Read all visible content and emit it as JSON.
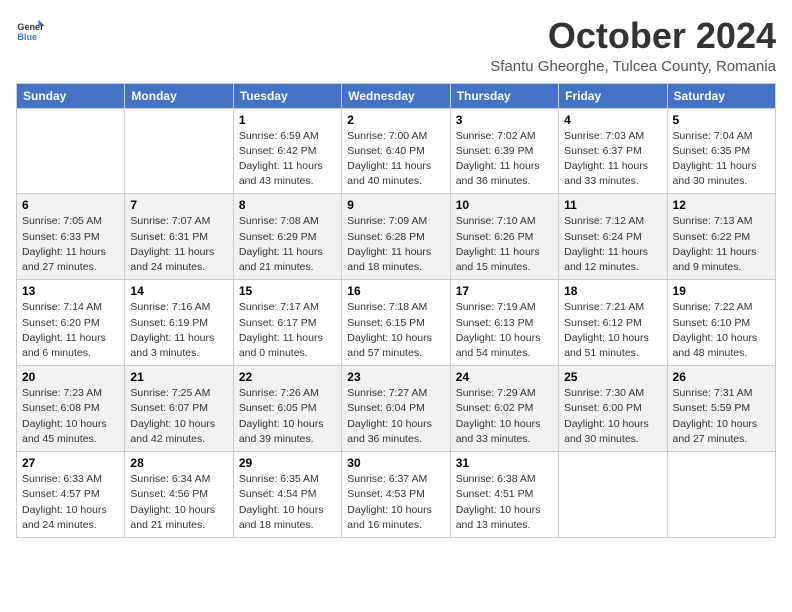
{
  "header": {
    "logo_general": "General",
    "logo_blue": "Blue",
    "month_title": "October 2024",
    "subtitle": "Sfantu Gheorghe, Tulcea County, Romania"
  },
  "weekdays": [
    "Sunday",
    "Monday",
    "Tuesday",
    "Wednesday",
    "Thursday",
    "Friday",
    "Saturday"
  ],
  "weeks": [
    [
      {
        "day": "",
        "info": ""
      },
      {
        "day": "",
        "info": ""
      },
      {
        "day": "1",
        "info": "Sunrise: 6:59 AM\nSunset: 6:42 PM\nDaylight: 11 hours and 43 minutes."
      },
      {
        "day": "2",
        "info": "Sunrise: 7:00 AM\nSunset: 6:40 PM\nDaylight: 11 hours and 40 minutes."
      },
      {
        "day": "3",
        "info": "Sunrise: 7:02 AM\nSunset: 6:39 PM\nDaylight: 11 hours and 36 minutes."
      },
      {
        "day": "4",
        "info": "Sunrise: 7:03 AM\nSunset: 6:37 PM\nDaylight: 11 hours and 33 minutes."
      },
      {
        "day": "5",
        "info": "Sunrise: 7:04 AM\nSunset: 6:35 PM\nDaylight: 11 hours and 30 minutes."
      }
    ],
    [
      {
        "day": "6",
        "info": "Sunrise: 7:05 AM\nSunset: 6:33 PM\nDaylight: 11 hours and 27 minutes."
      },
      {
        "day": "7",
        "info": "Sunrise: 7:07 AM\nSunset: 6:31 PM\nDaylight: 11 hours and 24 minutes."
      },
      {
        "day": "8",
        "info": "Sunrise: 7:08 AM\nSunset: 6:29 PM\nDaylight: 11 hours and 21 minutes."
      },
      {
        "day": "9",
        "info": "Sunrise: 7:09 AM\nSunset: 6:28 PM\nDaylight: 11 hours and 18 minutes."
      },
      {
        "day": "10",
        "info": "Sunrise: 7:10 AM\nSunset: 6:26 PM\nDaylight: 11 hours and 15 minutes."
      },
      {
        "day": "11",
        "info": "Sunrise: 7:12 AM\nSunset: 6:24 PM\nDaylight: 11 hours and 12 minutes."
      },
      {
        "day": "12",
        "info": "Sunrise: 7:13 AM\nSunset: 6:22 PM\nDaylight: 11 hours and 9 minutes."
      }
    ],
    [
      {
        "day": "13",
        "info": "Sunrise: 7:14 AM\nSunset: 6:20 PM\nDaylight: 11 hours and 6 minutes."
      },
      {
        "day": "14",
        "info": "Sunrise: 7:16 AM\nSunset: 6:19 PM\nDaylight: 11 hours and 3 minutes."
      },
      {
        "day": "15",
        "info": "Sunrise: 7:17 AM\nSunset: 6:17 PM\nDaylight: 11 hours and 0 minutes."
      },
      {
        "day": "16",
        "info": "Sunrise: 7:18 AM\nSunset: 6:15 PM\nDaylight: 10 hours and 57 minutes."
      },
      {
        "day": "17",
        "info": "Sunrise: 7:19 AM\nSunset: 6:13 PM\nDaylight: 10 hours and 54 minutes."
      },
      {
        "day": "18",
        "info": "Sunrise: 7:21 AM\nSunset: 6:12 PM\nDaylight: 10 hours and 51 minutes."
      },
      {
        "day": "19",
        "info": "Sunrise: 7:22 AM\nSunset: 6:10 PM\nDaylight: 10 hours and 48 minutes."
      }
    ],
    [
      {
        "day": "20",
        "info": "Sunrise: 7:23 AM\nSunset: 6:08 PM\nDaylight: 10 hours and 45 minutes."
      },
      {
        "day": "21",
        "info": "Sunrise: 7:25 AM\nSunset: 6:07 PM\nDaylight: 10 hours and 42 minutes."
      },
      {
        "day": "22",
        "info": "Sunrise: 7:26 AM\nSunset: 6:05 PM\nDaylight: 10 hours and 39 minutes."
      },
      {
        "day": "23",
        "info": "Sunrise: 7:27 AM\nSunset: 6:04 PM\nDaylight: 10 hours and 36 minutes."
      },
      {
        "day": "24",
        "info": "Sunrise: 7:29 AM\nSunset: 6:02 PM\nDaylight: 10 hours and 33 minutes."
      },
      {
        "day": "25",
        "info": "Sunrise: 7:30 AM\nSunset: 6:00 PM\nDaylight: 10 hours and 30 minutes."
      },
      {
        "day": "26",
        "info": "Sunrise: 7:31 AM\nSunset: 5:59 PM\nDaylight: 10 hours and 27 minutes."
      }
    ],
    [
      {
        "day": "27",
        "info": "Sunrise: 6:33 AM\nSunset: 4:57 PM\nDaylight: 10 hours and 24 minutes."
      },
      {
        "day": "28",
        "info": "Sunrise: 6:34 AM\nSunset: 4:56 PM\nDaylight: 10 hours and 21 minutes."
      },
      {
        "day": "29",
        "info": "Sunrise: 6:35 AM\nSunset: 4:54 PM\nDaylight: 10 hours and 18 minutes."
      },
      {
        "day": "30",
        "info": "Sunrise: 6:37 AM\nSunset: 4:53 PM\nDaylight: 10 hours and 16 minutes."
      },
      {
        "day": "31",
        "info": "Sunrise: 6:38 AM\nSunset: 4:51 PM\nDaylight: 10 hours and 13 minutes."
      },
      {
        "day": "",
        "info": ""
      },
      {
        "day": "",
        "info": ""
      }
    ]
  ]
}
